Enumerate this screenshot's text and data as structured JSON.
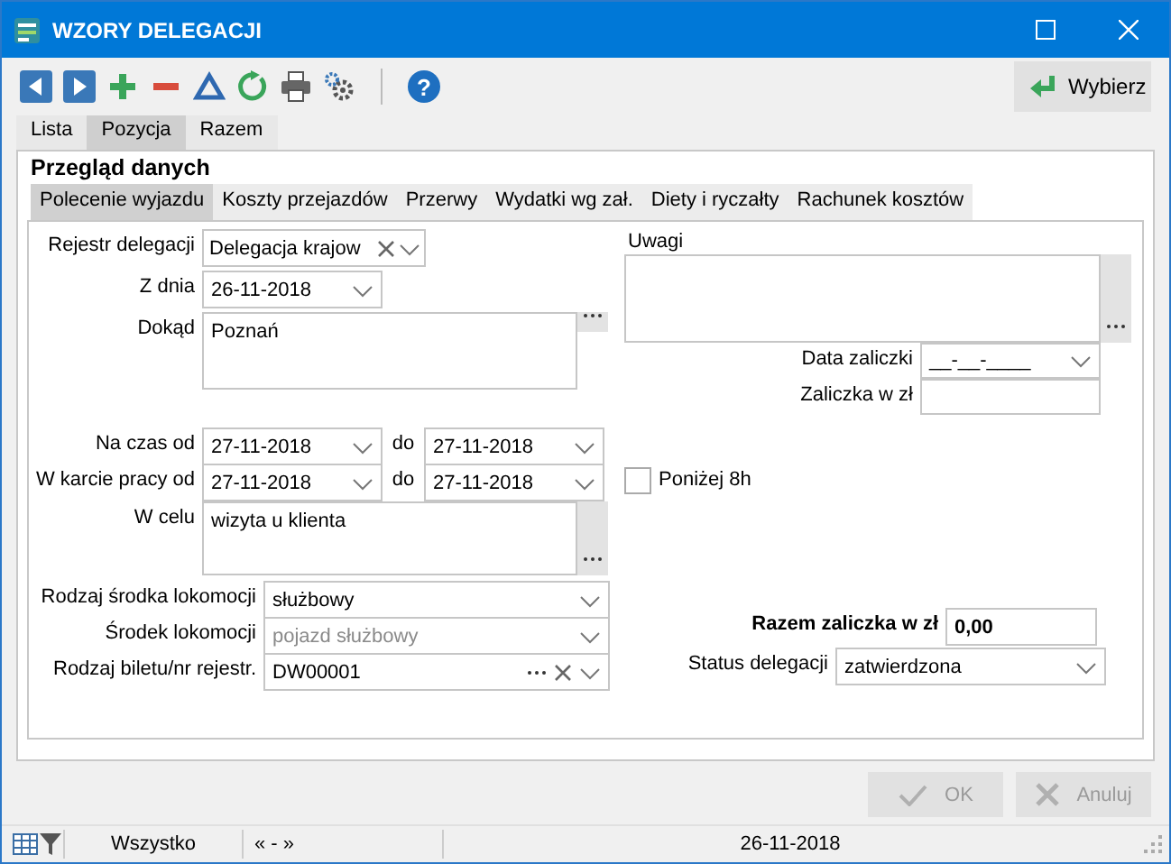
{
  "window": {
    "title": "WZORY DELEGACJI"
  },
  "toolbar": {
    "help": "?",
    "action": "Wybierz"
  },
  "tabs": [
    {
      "label": "Lista",
      "selected": false
    },
    {
      "label": "Pozycja",
      "selected": true
    },
    {
      "label": "Razem",
      "selected": false
    }
  ],
  "section_title": "Przegląd danych",
  "subtabs": [
    {
      "label": "Polecenie wyjazdu",
      "selected": true
    },
    {
      "label": "Koszty przejazdów",
      "selected": false
    },
    {
      "label": "Przerwy",
      "selected": false
    },
    {
      "label": "Wydatki wg zał.",
      "selected": false
    },
    {
      "label": "Diety i ryczałty",
      "selected": false
    },
    {
      "label": "Rachunek kosztów",
      "selected": false
    }
  ],
  "form": {
    "header_fields": [
      {
        "kind": "combo",
        "label": "Rejestr delegacji",
        "value": "Delegacja krajow",
        "clearable": true
      },
      {
        "kind": "date",
        "label": "Z dnia",
        "value": "26-11-2018"
      },
      {
        "kind": "memo",
        "label": "Dokąd",
        "value": "Poznań"
      }
    ],
    "period_fields": [
      {
        "label": "Na czas od",
        "from": "27-11-2018",
        "to_label": "do",
        "to": "27-11-2018"
      },
      {
        "label": "W karcie pracy od",
        "from": "27-11-2018",
        "to_label": "do",
        "to": "27-11-2018"
      }
    ],
    "purpose": {
      "label": "W celu",
      "value": "wizyta u klienta"
    },
    "transport_fields": [
      {
        "label": "Rodzaj środka lokomocji",
        "value": "służbowy",
        "disabled": false,
        "clearable": false,
        "ellipsis": false
      },
      {
        "label": "Środek lokomocji",
        "value": "pojazd służbowy",
        "disabled": true,
        "clearable": false,
        "ellipsis": false
      },
      {
        "label": "Rodzaj biletu/nr rejestr.",
        "value": "DW00001",
        "disabled": false,
        "clearable": true,
        "ellipsis": true
      }
    ],
    "notes": {
      "label": "Uwagi"
    },
    "advance_fields": [
      {
        "kind": "date",
        "label": "Data zaliczki",
        "placeholder": "__-__-____"
      },
      {
        "kind": "text",
        "label": "Zaliczka w zł"
      }
    ],
    "below_8h": {
      "label": "Poniżej 8h",
      "checked": false
    },
    "total": {
      "label": "Razem zaliczka w zł",
      "value": "0,00"
    },
    "status": {
      "label": "Status delegacji",
      "value": "zatwierdzona"
    }
  },
  "buttons": [
    {
      "kind": "ok",
      "label": "OK",
      "disabled": true
    },
    {
      "kind": "cancel",
      "label": "Anuluj",
      "disabled": true
    }
  ],
  "status_bar": {
    "filter": "Wszystko",
    "range": "« - »",
    "date": "26-11-2018"
  }
}
